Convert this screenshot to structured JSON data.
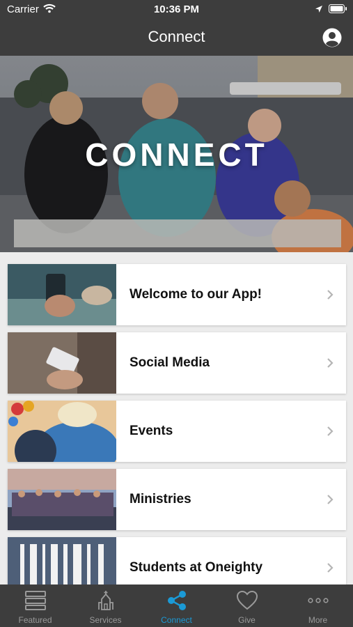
{
  "status_bar": {
    "carrier": "Carrier",
    "time": "10:36 PM"
  },
  "nav": {
    "title": "Connect"
  },
  "hero": {
    "title": "CONNECT"
  },
  "list": {
    "items": [
      {
        "label": "Welcome to our App!"
      },
      {
        "label": "Social Media"
      },
      {
        "label": "Events"
      },
      {
        "label": "Ministries"
      },
      {
        "label": "Students at Oneighty"
      }
    ]
  },
  "tabs": [
    {
      "label": "Featured",
      "icon": "featured-icon"
    },
    {
      "label": "Services",
      "icon": "church-icon"
    },
    {
      "label": "Connect",
      "icon": "share-icon",
      "active": true
    },
    {
      "label": "Give",
      "icon": "heart-icon"
    },
    {
      "label": "More",
      "icon": "more-icon"
    }
  ],
  "colors": {
    "bar_background": "#3d3d3d",
    "accent": "#1b9ad6",
    "inactive": "#9a9a9a",
    "list_background": "#ececec"
  }
}
